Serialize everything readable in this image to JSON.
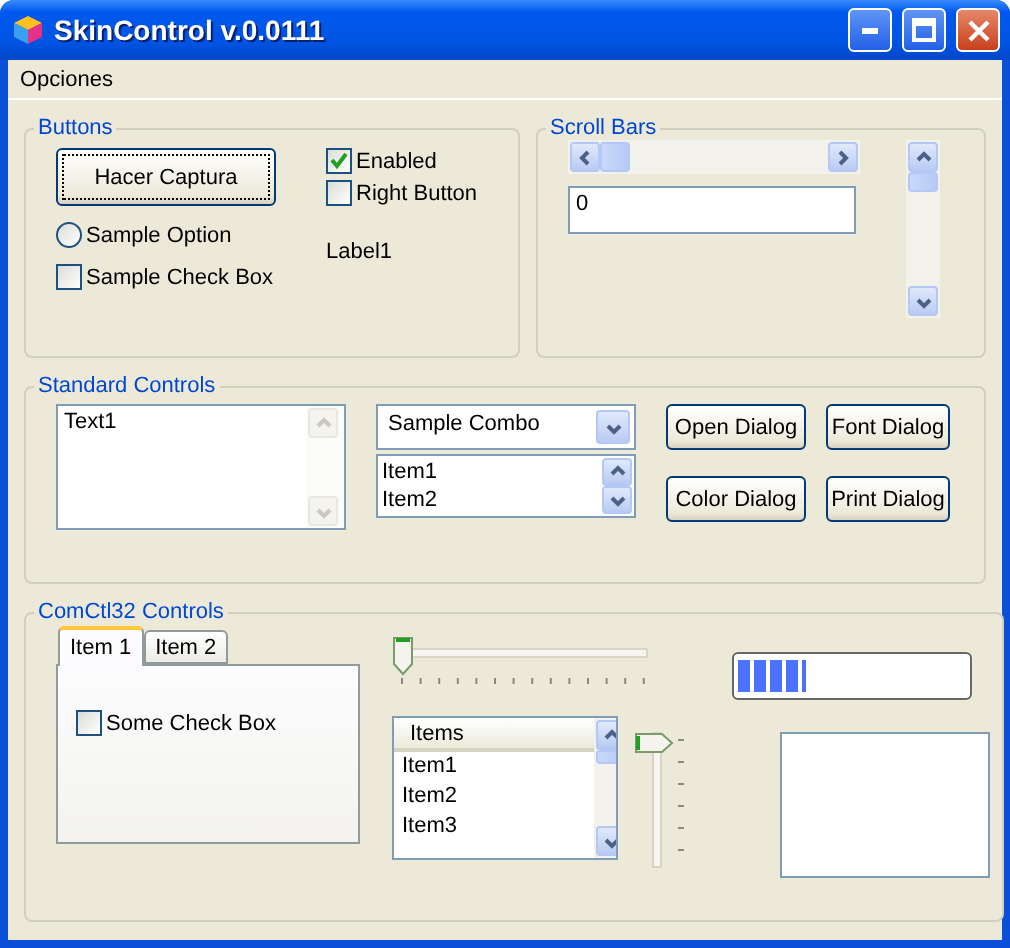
{
  "window": {
    "title": "SkinControl v.0.0111"
  },
  "menu": [
    {
      "label": "Opciones"
    }
  ],
  "buttons_group": {
    "title": "Buttons",
    "capture_button": "Hacer Captura",
    "option": {
      "label": "Sample Option",
      "selected": false
    },
    "check_box": {
      "label": "Sample Check Box",
      "checked": false
    },
    "enabled": {
      "label": "Enabled",
      "checked": true
    },
    "right_button": {
      "label": "Right Button",
      "checked": false
    },
    "label": "Label1"
  },
  "scroll_bars": {
    "title": "Scroll Bars",
    "value": "0"
  },
  "standard_controls": {
    "title": "Standard Controls",
    "text": "Text1",
    "combo": "Sample Combo",
    "list": [
      "Item1",
      "Item2"
    ],
    "buttons": [
      "Open Dialog",
      "Font Dialog",
      "Color Dialog",
      "Print Dialog"
    ]
  },
  "comctl32": {
    "title": "ComCtl32 Controls",
    "tabs": [
      {
        "label": "Item 1",
        "selected": true
      },
      {
        "label": "Item 2",
        "selected": false
      }
    ],
    "tab_check": {
      "label": "Some Check Box",
      "checked": false
    },
    "h_slider": {
      "level": 0
    },
    "progress": {
      "level": 0.3
    },
    "list_view": {
      "columns": [
        "Items"
      ],
      "rows": [
        "Item1",
        "Item2",
        "Item3"
      ]
    },
    "v_slider": {
      "level": 0
    }
  }
}
